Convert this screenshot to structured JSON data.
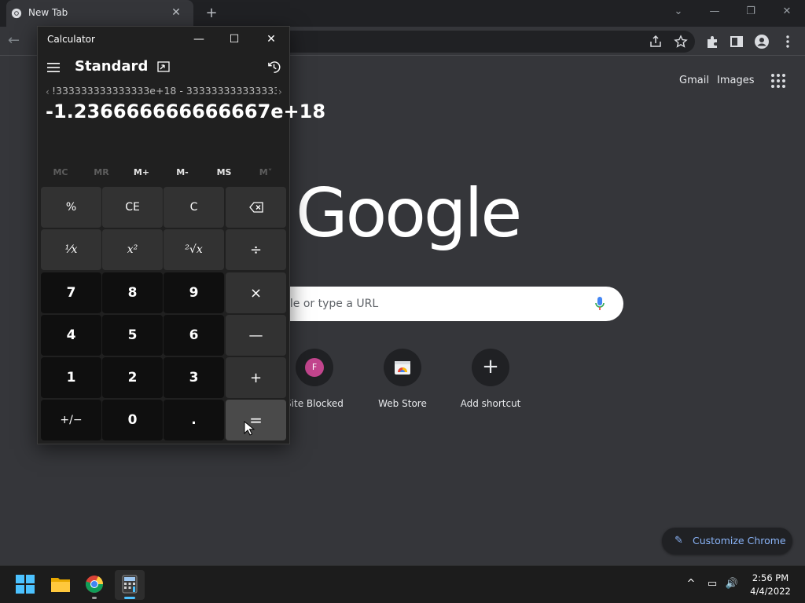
{
  "browser": {
    "tab_title": "New Tab",
    "new_tab_symbol": "+",
    "tab_close_symbol": "✕",
    "back_symbol": "←",
    "window_controls": [
      "⌄",
      "—",
      "❐",
      "✕"
    ]
  },
  "newtab": {
    "gmail_label": "Gmail",
    "images_label": "Images",
    "logo_text": "Google",
    "search_placeholder": "gle or type a URL",
    "shortcuts": [
      {
        "label": "Site Blocked",
        "initial": "F"
      },
      {
        "label": "Web Store"
      },
      {
        "label": "Add shortcut",
        "symbol": "+"
      }
    ],
    "customize_label": "Customize Chrome",
    "customize_symbol": "✎"
  },
  "calculator": {
    "title": "Calculator",
    "mode": "Standard",
    "expression": "!333333333333333e+18 - 3333333333333333 =",
    "display": "-1.236666666666667e+18",
    "window_controls": [
      "—",
      "☐",
      "✕"
    ],
    "memory": [
      {
        "label": "MC",
        "enabled": false
      },
      {
        "label": "MR",
        "enabled": false
      },
      {
        "label": "M+",
        "enabled": true
      },
      {
        "label": "M-",
        "enabled": true
      },
      {
        "label": "MS",
        "enabled": true
      },
      {
        "label": "M˅",
        "enabled": false
      }
    ],
    "keys": {
      "percent": "%",
      "ce": "CE",
      "c": "C",
      "backspace": "⌫",
      "reciprocal": "¹⁄x",
      "square": "x²",
      "sqrt": "²√x",
      "divide": "÷",
      "seven": "7",
      "eight": "8",
      "nine": "9",
      "multiply": "×",
      "four": "4",
      "five": "5",
      "six": "6",
      "minus": "—",
      "one": "1",
      "two": "2",
      "three": "3",
      "plus": "+",
      "negate": "+/−",
      "zero": "0",
      "decimal": ".",
      "equals": "="
    }
  },
  "taskbar": {
    "time": "2:56 PM",
    "date": "4/4/2022",
    "tray_symbols": [
      "^",
      "▭",
      "🔊"
    ]
  },
  "colors": {
    "chrome_dark": "#202124",
    "chrome_surface": "#35363a",
    "calc_bg": "#202020",
    "accent_link": "#8ab4f8",
    "shortcut_avatar": "#c2458d"
  }
}
